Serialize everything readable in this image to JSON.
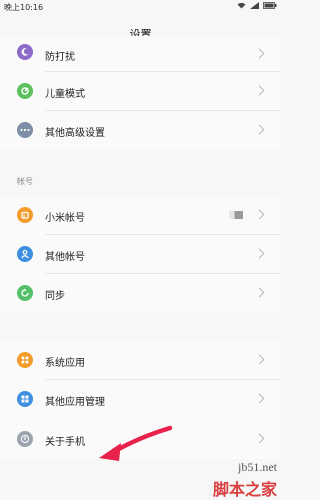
{
  "status_bar": {
    "time": "晚上10:16"
  },
  "header": {
    "title": "设置"
  },
  "group1": {
    "items": [
      {
        "label": "防打扰",
        "icon": "moon-icon",
        "color": "#8c6bc8"
      },
      {
        "label": "儿童模式",
        "icon": "child-mode-icon",
        "color": "#5cc05c"
      },
      {
        "label": "其他高级设置",
        "icon": "more-dots-icon",
        "color": "#7d8fa6"
      }
    ]
  },
  "accounts": {
    "header": "帐号",
    "items": [
      {
        "label": "小米帐号",
        "icon": "mi-account-icon",
        "color": "#f39c2b"
      },
      {
        "label": "其他帐号",
        "icon": "user-icon",
        "color": "#3f8fe0"
      },
      {
        "label": "同步",
        "icon": "sync-icon",
        "color": "#55c06a"
      }
    ]
  },
  "apps": {
    "items": [
      {
        "label": "系统应用",
        "icon": "apps-grid-icon",
        "color": "#f39c2b"
      },
      {
        "label": "其他应用管理",
        "icon": "app-manage-icon",
        "color": "#3f8fe0"
      }
    ]
  },
  "about": {
    "items": [
      {
        "label": "关于手机",
        "icon": "info-icon",
        "color": "#9aa3ad"
      }
    ]
  },
  "watermark": {
    "site": "jb51.net",
    "brand": "脚本之家"
  }
}
